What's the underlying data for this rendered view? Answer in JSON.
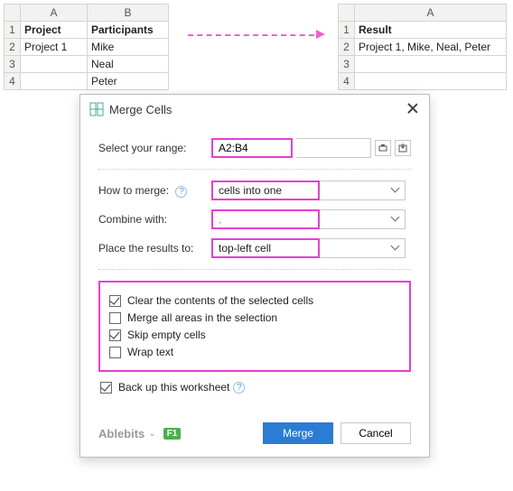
{
  "sheet_left": {
    "cols": [
      "A",
      "B"
    ],
    "rows": [
      "1",
      "2",
      "3",
      "4"
    ],
    "headers": [
      "Project",
      "Participants"
    ],
    "data": [
      [
        "Project 1",
        "Mike"
      ],
      [
        "",
        "Neal"
      ],
      [
        "",
        "Peter"
      ]
    ]
  },
  "sheet_right": {
    "cols": [
      "A"
    ],
    "rows": [
      "1",
      "2",
      "3",
      "4"
    ],
    "header": "Result",
    "data": [
      "Project 1, Mike, Neal, Peter",
      "",
      ""
    ]
  },
  "dialog": {
    "title": "Merge Cells",
    "labels": {
      "range": "Select your range:",
      "how": "How to merge:",
      "combine": "Combine with:",
      "place": "Place the results to:"
    },
    "range_value": "A2:B4",
    "how_value": "cells into one",
    "combine_value": ", ",
    "place_value": "top-left cell",
    "options": {
      "clear": "Clear the contents of the selected cells",
      "merge_all": "Merge all areas in the selection",
      "skip_empty": "Skip empty cells",
      "wrap": "Wrap text"
    },
    "backup": "Back up this worksheet",
    "brand": "Ablebits",
    "f1": "F1",
    "buttons": {
      "merge": "Merge",
      "cancel": "Cancel"
    }
  }
}
